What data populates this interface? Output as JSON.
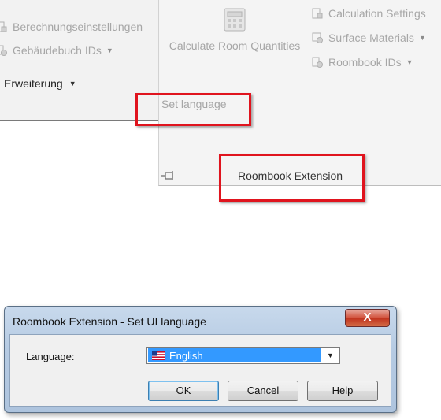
{
  "ribbon": {
    "left_panel": {
      "items": [
        {
          "label": "Berechnungseinstellungen",
          "icon": "settings-icon"
        },
        {
          "label": "Gebäudebuch IDs",
          "icon": "id-icon",
          "has_dropdown": true
        }
      ],
      "extension_label": "Erweiterung"
    },
    "right_panel": {
      "calculate_label": "Calculate Room Quantities",
      "items": [
        {
          "label": "Calculation Settings",
          "icon": "settings-icon"
        },
        {
          "label": "Surface Materials",
          "icon": "material-icon",
          "has_dropdown": true
        },
        {
          "label": "Roombook IDs",
          "icon": "id-icon",
          "has_dropdown": true
        }
      ],
      "set_language_label": "Set language",
      "panel_title": "Roombook Extension"
    },
    "highlight_color": "#e0141e"
  },
  "dialog": {
    "title": "Roombook Extension - Set UI language",
    "close_label": "X",
    "language_label": "Language:",
    "language_value": "English",
    "buttons": {
      "ok": "OK",
      "cancel": "Cancel",
      "help": "Help"
    }
  }
}
